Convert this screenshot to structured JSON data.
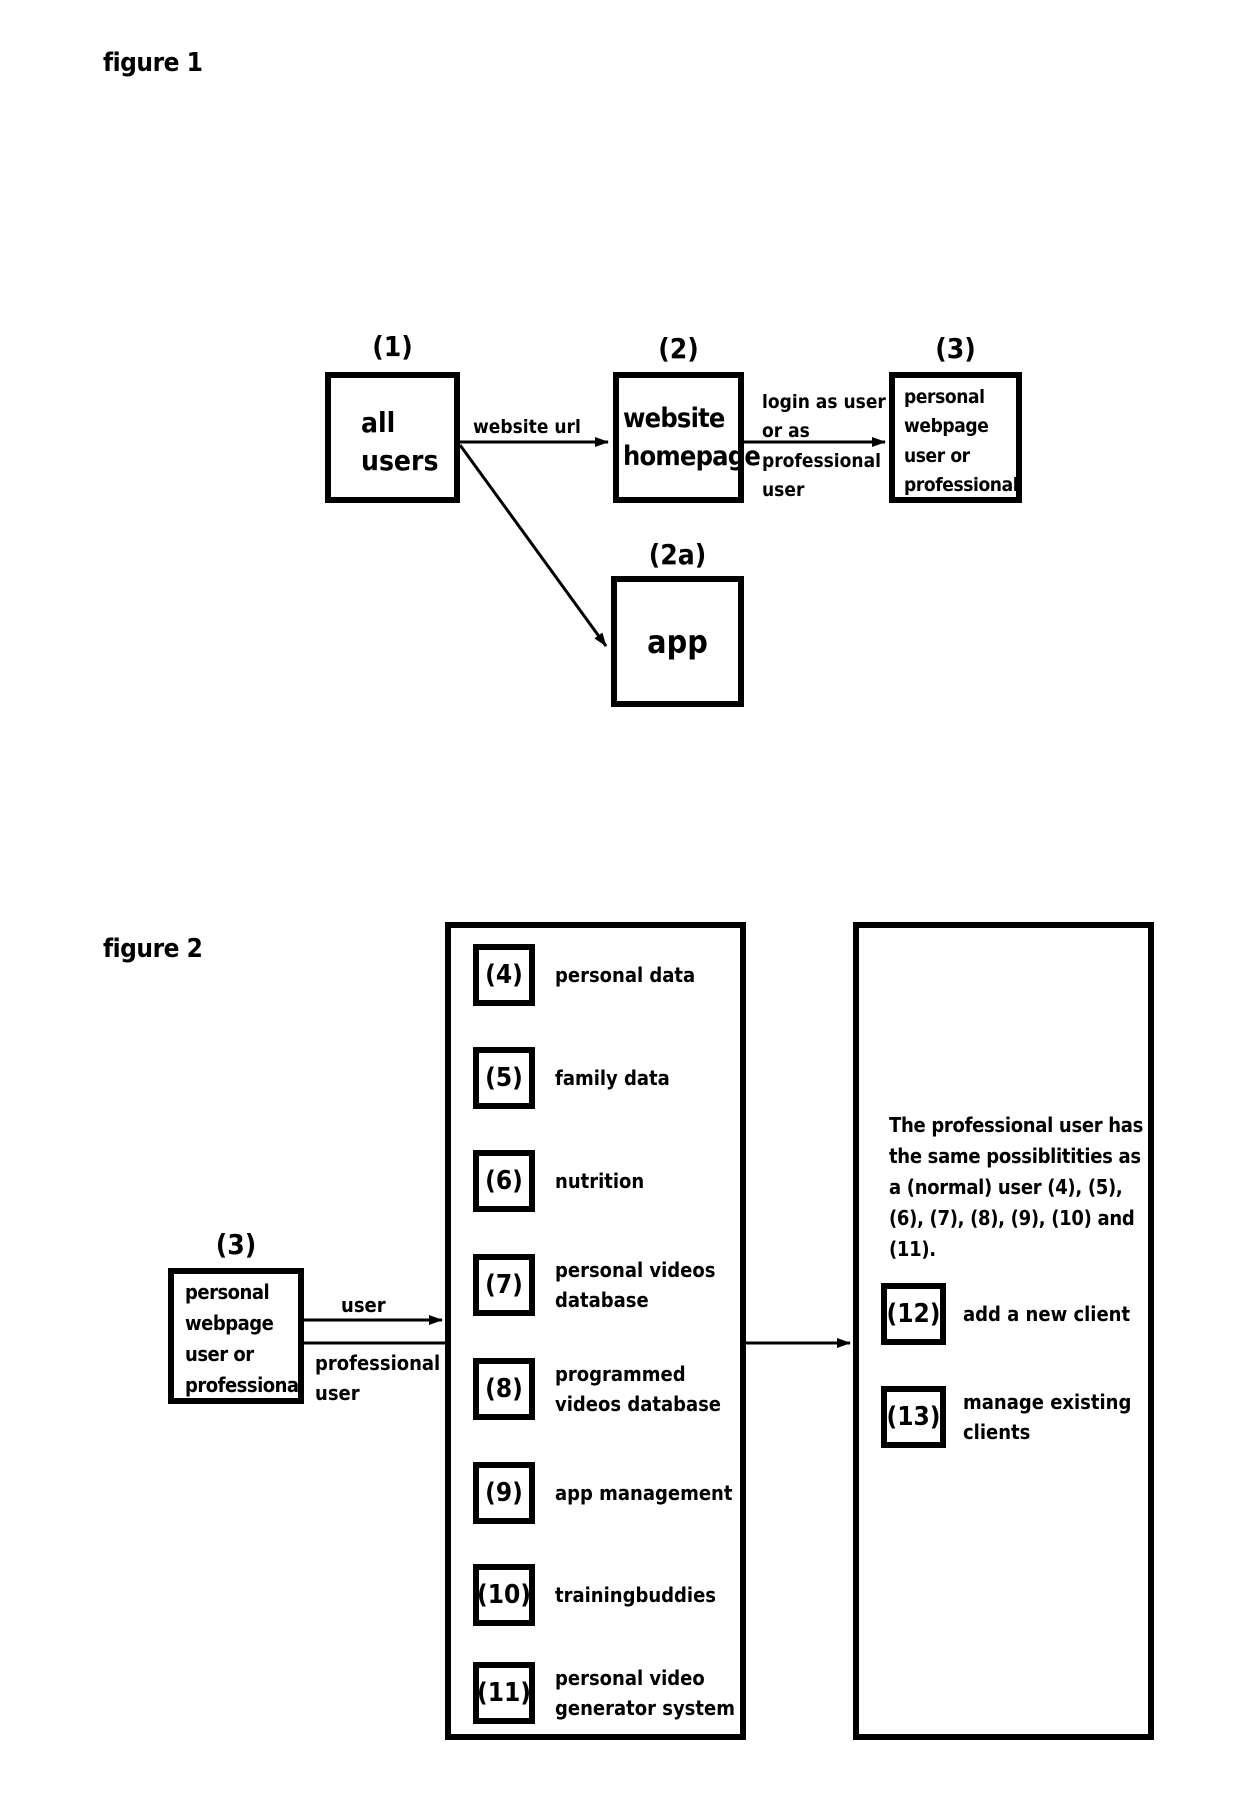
{
  "figure1": {
    "title": "figure 1",
    "nodes": [
      {
        "id": "1",
        "ref": "(1)",
        "lines": [
          "all",
          "users"
        ]
      },
      {
        "id": "2",
        "ref": "(2)",
        "lines": [
          "website",
          "homepage"
        ]
      },
      {
        "id": "3",
        "ref": "(3)",
        "lines": [
          "personal",
          "webpage",
          "user or",
          "professional"
        ]
      },
      {
        "id": "2a",
        "ref": "(2a)",
        "lines": [
          "app"
        ]
      }
    ],
    "edges": [
      {
        "from": "1",
        "to": "2",
        "label": "website url"
      },
      {
        "from": "2",
        "to": "3",
        "label_lines": [
          "login as user",
          "or as",
          "professional",
          "user"
        ]
      },
      {
        "from": "1",
        "to": "2a",
        "label": ""
      }
    ]
  },
  "figure2": {
    "title": "figure 2",
    "source": {
      "ref": "(3)",
      "lines": [
        "personal",
        "webpage",
        "user or",
        "professional"
      ]
    },
    "edge_user": "user",
    "edge_professional_lines": [
      "professional",
      "user"
    ],
    "user_items": [
      {
        "ref": "(4)",
        "lines": [
          "personal data"
        ]
      },
      {
        "ref": "(5)",
        "lines": [
          "family data"
        ]
      },
      {
        "ref": "(6)",
        "lines": [
          "nutrition"
        ]
      },
      {
        "ref": "(7)",
        "lines": [
          "personal videos",
          "database"
        ]
      },
      {
        "ref": "(8)",
        "lines": [
          "programmed",
          "videos database"
        ]
      },
      {
        "ref": "(9)",
        "lines": [
          "app management"
        ]
      },
      {
        "ref": "(10)",
        "lines": [
          "trainingbuddies"
        ]
      },
      {
        "ref": "(11)",
        "lines": [
          "personal video",
          "generator system"
        ]
      }
    ],
    "professional_note_lines": [
      "The professional user has",
      "the same possiblitities as",
      "a (normal) user (4), (5),",
      "(6), (7), (8), (9), (10) and",
      "(11)."
    ],
    "professional_items": [
      {
        "ref": "(12)",
        "lines": [
          "add a new client"
        ]
      },
      {
        "ref": "(13)",
        "lines": [
          "manage existing",
          "clients"
        ]
      }
    ]
  }
}
